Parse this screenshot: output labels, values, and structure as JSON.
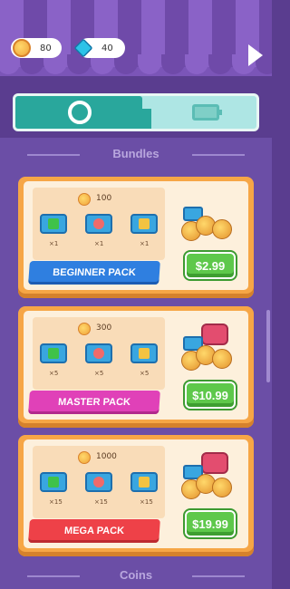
{
  "header": {
    "coins": "80",
    "gems": "40"
  },
  "tabs": [
    {
      "id": "shop",
      "icon": "circle-icon",
      "active": true
    },
    {
      "id": "energy",
      "icon": "battery-bolt-icon",
      "active": false
    }
  ],
  "sections": {
    "bundles_title": "Bundles",
    "coins_title": "Coins"
  },
  "bundles": [
    {
      "name": "BEGINNER PACK",
      "coins": "100",
      "qty": [
        "×1",
        "×1",
        "×1"
      ],
      "price": "$2.99",
      "label_color": "#2f7fe0"
    },
    {
      "name": "MASTER PACK",
      "coins": "300",
      "qty": [
        "×5",
        "×5",
        "×5"
      ],
      "price": "$10.99",
      "label_color": "#e041b8"
    },
    {
      "name": "MEGA PACK",
      "coins": "1000",
      "qty": [
        "×15",
        "×15",
        "×15"
      ],
      "price": "$19.99",
      "label_color": "#ee4148"
    }
  ],
  "colors": {
    "background": "#5a3d8f",
    "card": "#f6a646",
    "price_button": "#5ec84b",
    "tab_active": "#29a79c"
  }
}
